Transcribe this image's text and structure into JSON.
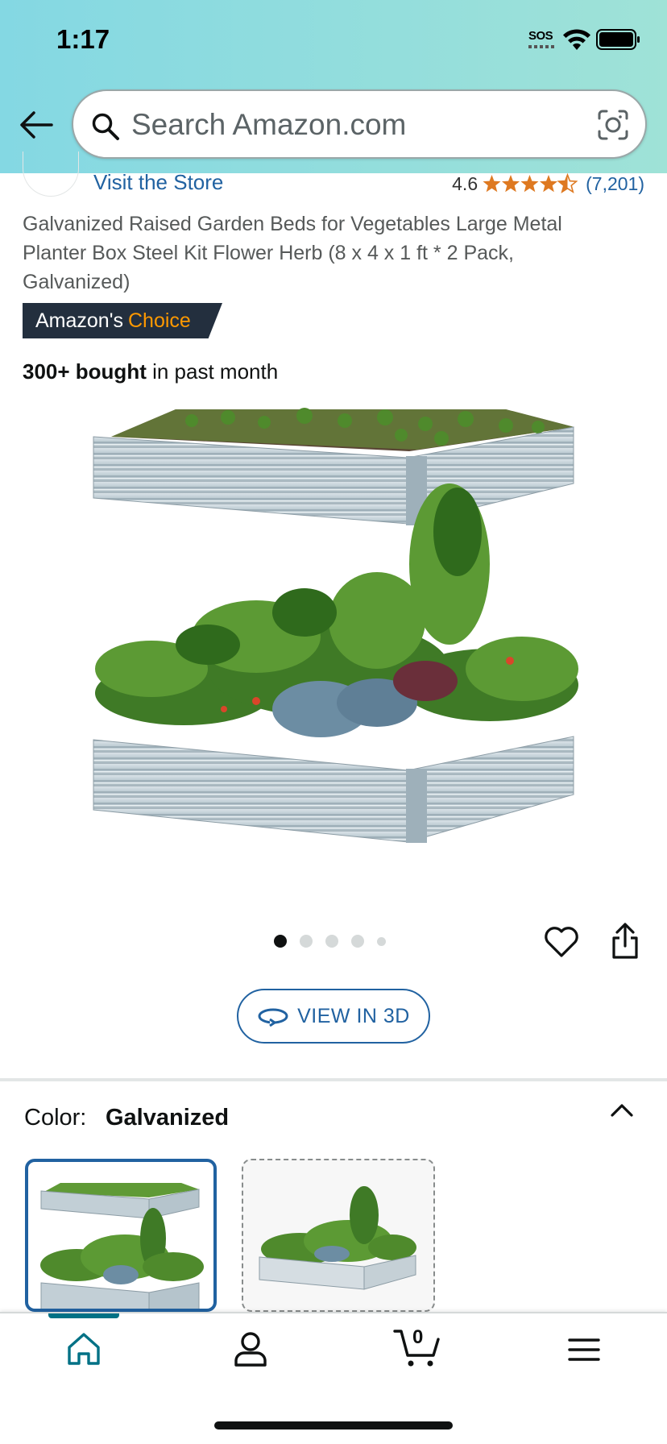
{
  "status_bar": {
    "time": "1:17",
    "sos": "SOS"
  },
  "search": {
    "placeholder": "Search Amazon.com"
  },
  "store": {
    "link_label": "Visit the Store"
  },
  "rating": {
    "value": "4.6",
    "stars": 4.5,
    "count": "(7,201)"
  },
  "product": {
    "title": "Galvanized Raised Garden Beds for Vegetables Large Metal Planter Box Steel Kit Flower Herb (8 x 4 x 1 ft * 2 Pack, Galvanized)",
    "badge_prefix": "Amazon's",
    "badge_highlight": "Choice",
    "bought_strong": "300+ bought",
    "bought_rest": " in past month"
  },
  "carousel": {
    "total": 5,
    "active": 0
  },
  "view3d": {
    "label": "VIEW IN 3D"
  },
  "color": {
    "label": "Color:",
    "selected": "Galvanized"
  },
  "cart": {
    "count": "0"
  },
  "colors": {
    "link": "#2162a1",
    "badge_bg": "#232f3e",
    "badge_accent": "#ff9900",
    "nav_active": "#007185",
    "star": "#de7921"
  }
}
